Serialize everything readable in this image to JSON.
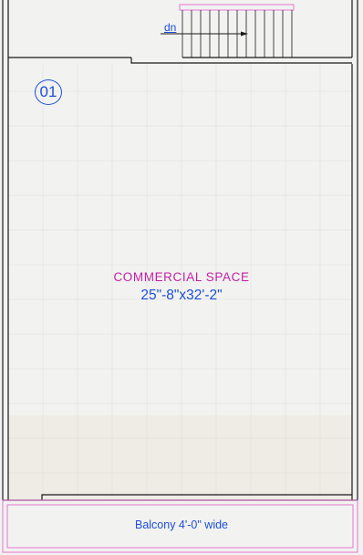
{
  "room": {
    "number": "01",
    "name": "COMMERCIAL SPACE",
    "size": "25\"-8\"x32'-2\""
  },
  "stair": {
    "direction_label": "dn"
  },
  "balcony": {
    "label": "Balcony 4'-0\" wide"
  },
  "colors": {
    "room_name": "#c41fa6",
    "dimension_text": "#1d4fd6",
    "balcony_outline": "#e36ad0",
    "wall_lines": "#1a1a1a",
    "grid_lines": "#dcdcdc"
  }
}
